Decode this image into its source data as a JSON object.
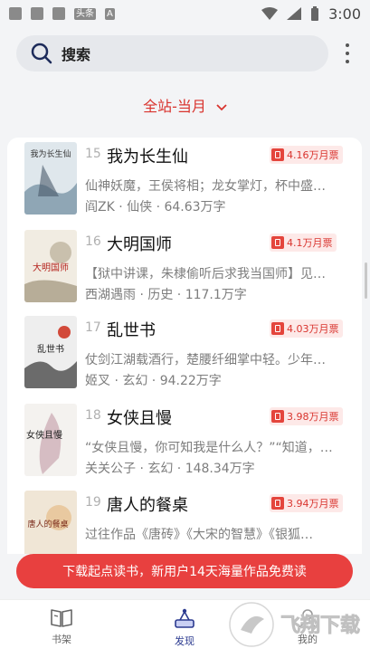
{
  "status_bar": {
    "badge1": "头条",
    "badge2": "A",
    "time": "3:00"
  },
  "search": {
    "label": "搜索"
  },
  "filter": {
    "label": "全站-当月"
  },
  "books": [
    {
      "rank": "15",
      "title": "我为长生仙",
      "tickets": "4.16万月票",
      "desc": "仙神妖魔，王侯将相；龙女掌灯，杯中盛…",
      "meta": "阎ZK · 仙侠 · 64.63万字",
      "cover_text": "我为长生仙"
    },
    {
      "rank": "16",
      "title": "大明国师",
      "tickets": "4.1万月票",
      "desc": "【狱中讲课，朱棣偷听后求我当国师】见…",
      "meta": "西湖遇雨 · 历史 · 117.1万字",
      "cover_text": "大明国师"
    },
    {
      "rank": "17",
      "title": "乱世书",
      "tickets": "4.03万月票",
      "desc": "仗剑江湖载酒行，楚腰纤细掌中轻。少年…",
      "meta": "姬叉 · 玄幻 · 94.22万字",
      "cover_text": "乱世书"
    },
    {
      "rank": "18",
      "title": "女侠且慢",
      "tickets": "3.98万月票",
      "desc": "“女侠且慢，你可知我是什么人？”“知道，…",
      "meta": "关关公子 · 玄幻 · 148.34万字",
      "cover_text": "女侠且慢"
    },
    {
      "rank": "19",
      "title": "唐人的餐桌",
      "tickets": "3.94万月票",
      "desc": "过往作品《唐砖》《大宋的智慧》《银狐…",
      "meta": "",
      "cover_text": "唐人的餐桌"
    }
  ],
  "promo": {
    "text": "下载起点读书，新用户14天海量作品免费读"
  },
  "tabs": [
    {
      "label": "书架"
    },
    {
      "label": "发现"
    },
    {
      "label": "我的"
    }
  ],
  "watermark": {
    "text": "飞翔下载"
  },
  "colors": {
    "accent": "#d9342e",
    "promo": "#e8403f",
    "tab_active": "#2b3a8f"
  }
}
